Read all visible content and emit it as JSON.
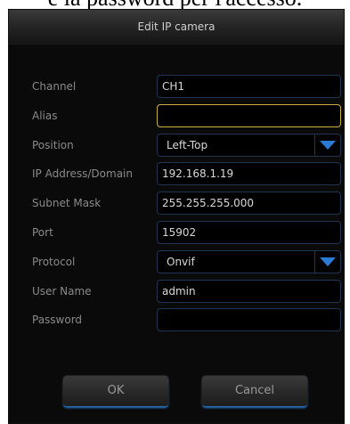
{
  "top_text": "e la password per l'accesso.",
  "dialog": {
    "title": "Edit IP camera",
    "fields": [
      {
        "label": "Channel",
        "value": ""
      },
      {
        "label": "Alias",
        "value": ""
      },
      {
        "label": "Position",
        "value": ""
      },
      {
        "label": "IP Address/Domain",
        "value": ""
      },
      {
        "label": "Subnet Mask",
        "value": ""
      },
      {
        "label": "Port",
        "value": ""
      },
      {
        "label": "Protocol",
        "value": ""
      },
      {
        "label": "User Name",
        "value": ""
      },
      {
        "label": "Password",
        "value": ""
      }
    ],
    "channel": "CH1",
    "alias": "",
    "position": "Left-Top",
    "ip_address": "192.168.1.19",
    "subnet_mask": "255.255.255.000",
    "port": "15902",
    "protocol": "Onvif",
    "user_name": "admin",
    "password": "",
    "ok_label": "OK",
    "cancel_label": "Cancel"
  },
  "colors": {
    "background": "#0a0a0a",
    "label_text": "#8a8a8a",
    "field_border": "#1f3550",
    "focus_border": "#c9b23b",
    "dropdown_arrow": "#2a7bd6",
    "button_glow": "#2a78c8"
  },
  "icons": {
    "dropdown": "chevron-down-icon"
  }
}
